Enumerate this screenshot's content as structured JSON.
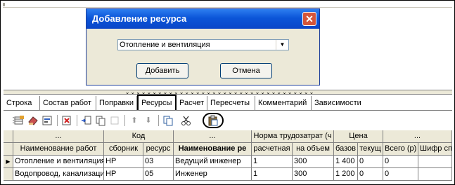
{
  "dialog": {
    "title": "Добавление ресурса",
    "close_glyph": "✕",
    "selected_value": "Отопление и вентиляция",
    "add_button": "Добавить",
    "cancel_button": "Отмена"
  },
  "splitter_grip": "⌄⌄⌄⌄⌄⌄⌄⌄⌄⌄⌄⌄⌄⌄⌄⌄⌄⌄⌄⌄⌄⌄⌄⌄⌄⌄⌄⌄⌄⌄⌄⌄⌄⌄⌄",
  "tabs": [
    "Строка",
    "Состав работ",
    "Поправки",
    "Ресурсы",
    "Расчет",
    "Пересчеты",
    "Комментарий",
    "Зависимости"
  ],
  "active_tab": "Ресурсы",
  "grid": {
    "group_headers": {
      "dots1": "...",
      "code": "Код",
      "dots2": "...",
      "labor_norm": "Норма трудозатрат (ч",
      "price": "Цена",
      "dots3": "..."
    },
    "columns": [
      "Наименование работ",
      "сборник",
      "ресурс",
      "Наименование ре",
      "расчетная",
      "на объем",
      "базов",
      "текущ",
      "Всего (р)",
      "Шифр спр"
    ],
    "rows": [
      [
        "Отопление и вентиляция",
        "НР",
        "03",
        "Ведущий инженер",
        "1",
        "300",
        "1 400",
        "0",
        "0",
        ""
      ],
      [
        "Водопровод, канализация",
        "НР",
        "05",
        "Инженер",
        "1",
        "300",
        "1 200",
        "0",
        "0",
        ""
      ]
    ]
  },
  "colors": {
    "title_bar": "#0b55d8",
    "close": "#d4553a",
    "dialog_bg": "#ece9d8"
  }
}
